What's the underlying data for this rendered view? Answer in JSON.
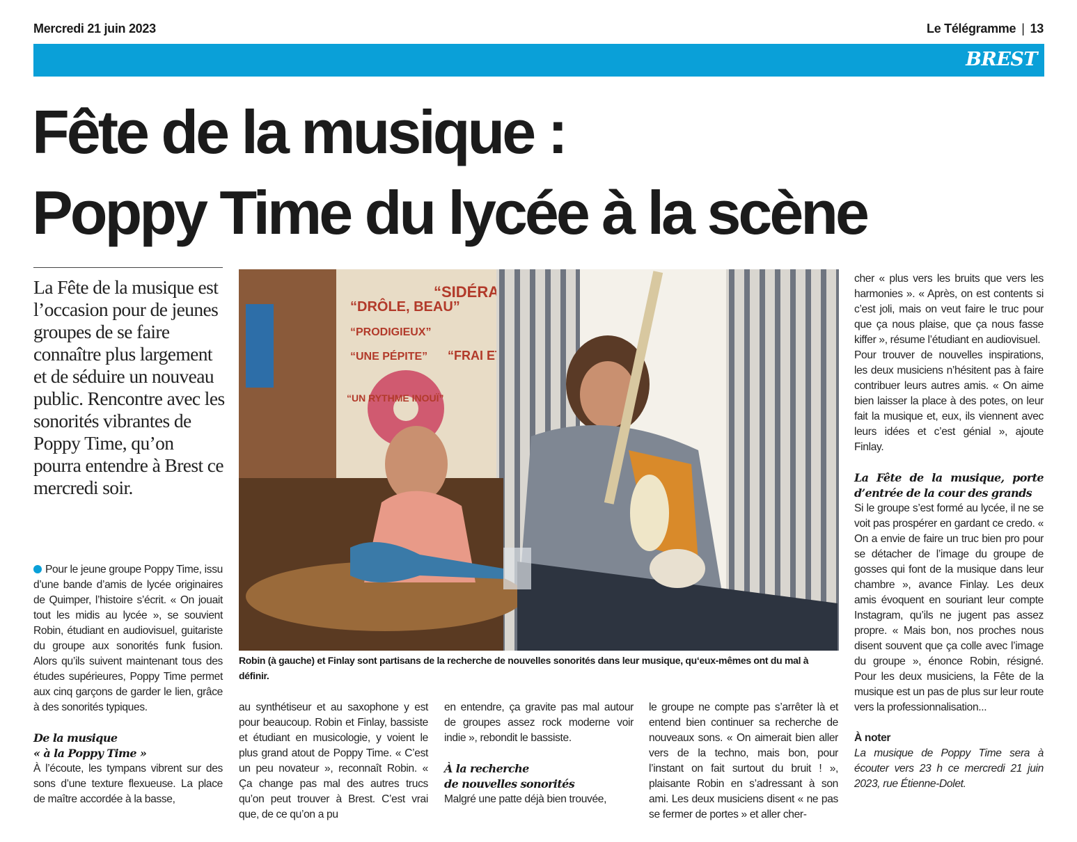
{
  "header": {
    "date": "Mercredi 21 juin 2023",
    "publication": "Le Télégramme",
    "separator": "|",
    "page_number": "13",
    "section": "BREST",
    "section_color": "#0aa0d8"
  },
  "article": {
    "headline_line1": "Fête de la musique :",
    "headline_line2": "Poppy Time du lycée à la scène",
    "intro": "La Fête de la musique est l’occasion pour de jeunes groupes de se faire connaître plus largement et de séduire un nouveau public. Rencontre avec les sonorités vibrantes de Poppy Time, qu’on pourra entendre à Brest ce mercredi soir.",
    "photo_caption": "Robin (à gauche) et Finlay sont partisans de la recherche de nouvelles sonorités dans leur musique, qu‘eux-mêmes ont du mal à définir.",
    "col1_p1": "Pour le jeune groupe Poppy Time, issu d’une bande d’amis de lycée originaires de Quimper, l’histoire s’écrit. « On jouait tout les midis au lycée », se souvient Robin, étudiant en audiovisuel, guitariste du groupe aux sonorités funk fusion. Alors qu’ils suivent maintenant tous des études supérieures, Poppy Time permet aux cinq garçons de garder le lien, grâce à des sonorités typiques.",
    "subhead1_line1": "De la musique",
    "subhead1_line2": "« à la Poppy Time »",
    "col1_p2": "À l’écoute, les tympans vibrent sur des sons d’une texture flexueuse. La place de maître accordée à la basse,",
    "col2_p1": "au synthétiseur et au saxophone y est pour beaucoup. Robin et Finlay, bassiste et étudiant en musicologie, y voient le plus grand atout de Poppy Time. « C’est un peu novateur », reconnaît Robin. « Ça change pas mal des autres trucs qu’on peut trouver à Brest. C’est vrai que, de ce qu’on a pu",
    "col3_p1": "en entendre, ça gravite pas mal autour de groupes assez rock moderne voir indie », rebondit le bassiste.",
    "subhead2_line1": "À la recherche",
    "subhead2_line2": "de nouvelles sonorités",
    "col3_p2": "Malgré une patte déjà bien trouvée,",
    "col4_p1": "le groupe ne compte pas s’arrêter là et entend bien continuer sa recherche de nouveaux sons. « On aimerait bien aller vers de la techno, mais bon, pour l’instant on fait surtout du bruit ! », plaisante Robin en s’adressant à son ami. Les deux musiciens disent « ne pas se fermer de portes » et aller cher-",
    "col5_p1": "cher « plus vers les bruits que vers les harmonies ». « Après, on est contents si c’est joli, mais on veut faire le truc pour que ça nous plaise, que ça nous fasse kiffer », résume l’étudiant en audiovisuel.",
    "col5_p2": "Pour trouver de nouvelles inspirations, les deux musiciens n’hésitent pas à faire contribuer leurs autres amis. « On aime bien laisser la place à des potes, on leur fait la musique et, eux, ils viennent avec leurs idées et c’est génial », ajoute Finlay.",
    "subhead3": "La Fête de la musique, porte d’entrée de la cour des grands",
    "col5_p3": "Si le groupe s’est formé au lycée, il ne se voit pas prospérer en gardant ce credo. « On a envie de faire un truc bien pro pour se détacher de l’image du groupe de gosses qui font de la musique dans leur chambre », avance Finlay. Les deux amis évoquent en souriant leur compte Instagram, qu’ils ne jugent pas assez propre. « Mais bon, nos proches nous disent souvent que ça colle avec l’image du groupe », énonce Robin, résigné. Pour les deux musiciens, la Fête de la musique est un pas de plus sur leur route vers la professionnalisation...",
    "note_title": "À noter",
    "note_text": "La musique de Poppy Time sera à écouter vers 23 h ce mercredi 21 juin 2023, rue Étienne-Dolet."
  },
  "photo": {
    "poster_texts": [
      "“DRÔLE, BEAU”",
      "“SIDÉRAN”",
      "“PRODIGIEUX”",
      "“UNE PÉPITE”",
      "“UN RYTHME INOUÏ”",
      "“FRAI ET PO”"
    ]
  }
}
